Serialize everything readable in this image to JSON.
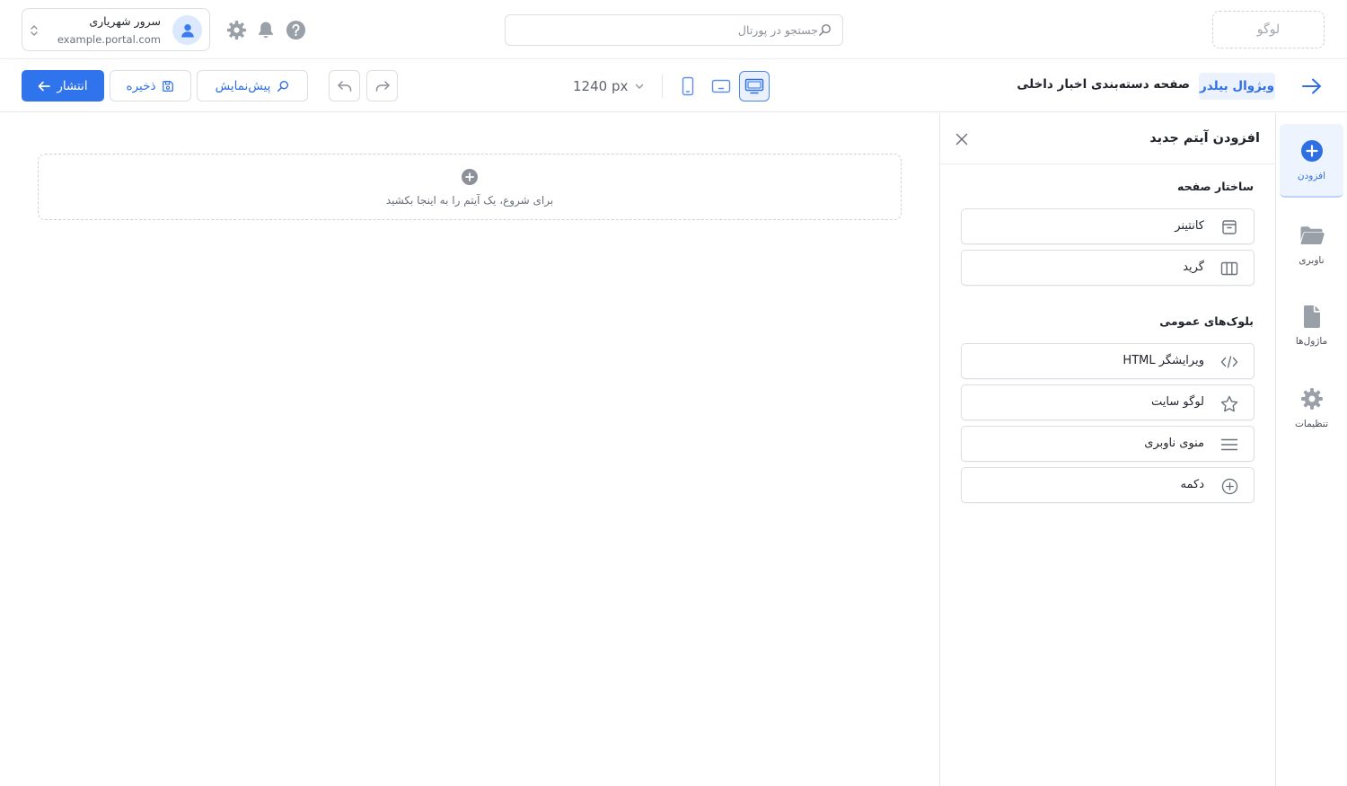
{
  "header": {
    "logo_text": "لوگو",
    "search": {
      "placeholder": "جستجو در پورتال",
      "value": ""
    },
    "user": {
      "name": "سرور شهریاری",
      "domain": "example.portal.com"
    },
    "icons": [
      "help-icon",
      "bell-icon",
      "gear-icon"
    ]
  },
  "toolbar": {
    "app_badge": "ویژوال بیلدر",
    "page_title": "صفحه دسته‌بندی اخبار داخلی",
    "devices": [
      "desktop",
      "tablet",
      "mobile"
    ],
    "active_device": "desktop",
    "width_value": "1240 px",
    "preview_label": "پیش‌نمایش",
    "save_label": "ذخیره",
    "publish_label": "انتشار"
  },
  "canvas": {
    "drop_hint": "برای شروع، یک آیتم را به اینجا بکشید"
  },
  "panel": {
    "title": "افزودن آیتم جدید",
    "sections": [
      {
        "title": "ساختار صفحه",
        "items": [
          {
            "label": "کانتینر",
            "icon": "container-icon"
          },
          {
            "label": "گرید",
            "icon": "grid-columns-icon"
          }
        ]
      },
      {
        "title": "بلوک‌های عمومی",
        "items": [
          {
            "label": "ویرایشگر HTML",
            "icon": "code-icon"
          },
          {
            "label": "لوگو سایت",
            "icon": "star-icon"
          },
          {
            "label": "منوی ناوبری",
            "icon": "menu-lines-icon"
          },
          {
            "label": "دکمه",
            "icon": "plus-circle-icon"
          }
        ]
      }
    ]
  },
  "rail": {
    "items": [
      {
        "label": "افزودن",
        "icon": "add-circle-icon",
        "active": true
      },
      {
        "label": "ناوبری",
        "icon": "folder-icon",
        "active": false
      },
      {
        "label": "ماژول‌ها",
        "icon": "document-icon",
        "active": false
      },
      {
        "label": "تنظیمات",
        "icon": "gear-icon",
        "active": false
      }
    ]
  },
  "colors": {
    "accent": "#2f74ec",
    "accent_light": "#ebf2fe",
    "border": "#dcdee3",
    "icon_gray": "#9aa0a8"
  }
}
